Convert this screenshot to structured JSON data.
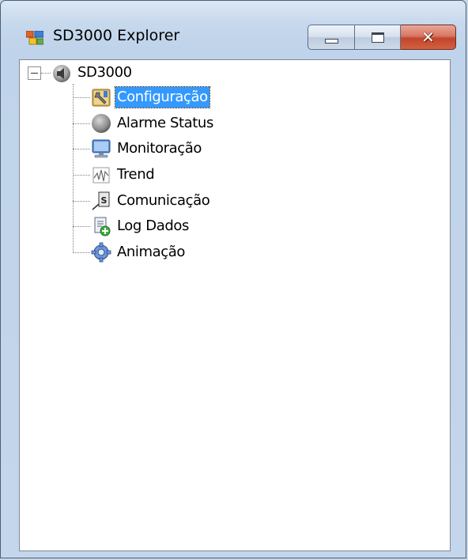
{
  "window": {
    "title": "SD3000 Explorer",
    "icons": {
      "app": "app-window-icon",
      "minimize": "minimize-icon",
      "maximize": "maximize-icon",
      "close": "close-icon"
    },
    "close_glyph": "✕"
  },
  "tree": {
    "root": {
      "label": "SD3000",
      "icon": "speaker-icon",
      "expanded": true
    },
    "children": [
      {
        "label": "Configuração",
        "icon": "configuration-tools-icon",
        "selected": true
      },
      {
        "label": "Alarme Status",
        "icon": "alarm-status-icon",
        "selected": false
      },
      {
        "label": "Monitoração",
        "icon": "monitor-icon",
        "selected": false
      },
      {
        "label": "Trend",
        "icon": "trend-chart-icon",
        "selected": false
      },
      {
        "label": "Comunicação",
        "icon": "communication-icon",
        "selected": false
      },
      {
        "label": "Log Dados",
        "icon": "log-data-icon",
        "selected": false
      },
      {
        "label": "Animação",
        "icon": "animation-gear-icon",
        "selected": false
      }
    ]
  },
  "colors": {
    "selection": "#3399ff",
    "close_button": "#c2452c",
    "title_bar": "#c6d8ec"
  }
}
